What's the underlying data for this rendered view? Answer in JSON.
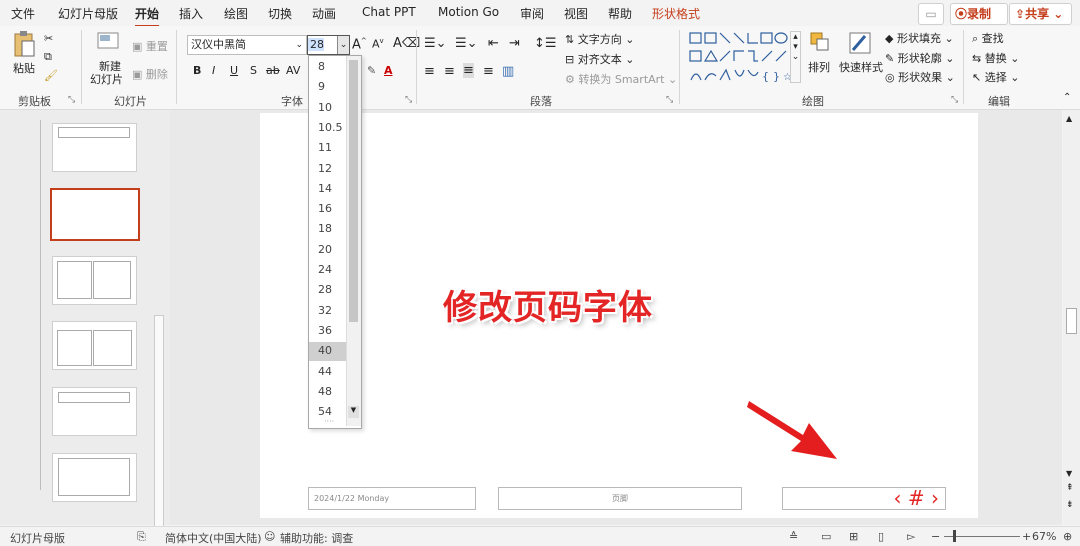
{
  "tabs": [
    {
      "label": "文件"
    },
    {
      "label": "幻灯片母版"
    },
    {
      "label": "开始"
    },
    {
      "label": "插入"
    },
    {
      "label": "绘图"
    },
    {
      "label": "切换"
    },
    {
      "label": "动画"
    },
    {
      "label": "Chat PPT"
    },
    {
      "label": "Motion Go"
    },
    {
      "label": "审阅"
    },
    {
      "label": "视图"
    },
    {
      "label": "帮助"
    },
    {
      "label": "形状格式"
    }
  ],
  "record_button": "录制",
  "share_button": "共享",
  "clipboard": {
    "paste": "粘贴",
    "group": "剪贴板"
  },
  "slides_group": {
    "new_slide_1": "新建",
    "new_slide_2": "幻灯片",
    "reset": "重置",
    "delete": "删除",
    "group": "幻灯片"
  },
  "font": {
    "name": "汉仪中黑简",
    "size": "28",
    "group": "字体",
    "bold": "B",
    "italic": "I",
    "underline": "U",
    "strike": "S",
    "shadow": "ab",
    "spacing": "AV"
  },
  "paragraph": {
    "text_direction": "文字方向",
    "align_text": "对齐文本",
    "smartart": "转换为 SmartArt",
    "group": "段落"
  },
  "drawing": {
    "arrange": "排列",
    "quick_styles": "快速样式",
    "fill": "形状填充",
    "outline": "形状轮廓",
    "effects": "形状效果",
    "group": "绘图"
  },
  "editing": {
    "find": "查找",
    "replace": "替换",
    "select": "选择",
    "group": "编辑"
  },
  "size_dropdown": {
    "options": [
      "8",
      "9",
      "10",
      "10.5",
      "11",
      "12",
      "14",
      "16",
      "18",
      "20",
      "24",
      "28",
      "32",
      "36",
      "40",
      "44",
      "48",
      "54"
    ],
    "highlighted": "40"
  },
  "slide": {
    "headline": "修改页码字体",
    "date_footer": "2024/1/22  Monday",
    "center_footer": "页脚",
    "page_number": "‹ # ›"
  },
  "status": {
    "view": "幻灯片母版",
    "language": "简体中文(中国大陆)",
    "accessibility": "辅助功能: 调查",
    "zoom": "67%"
  },
  "colors": {
    "accent": "#c43e1c",
    "headline": "#e32525",
    "arrow": "#e41e1e"
  }
}
